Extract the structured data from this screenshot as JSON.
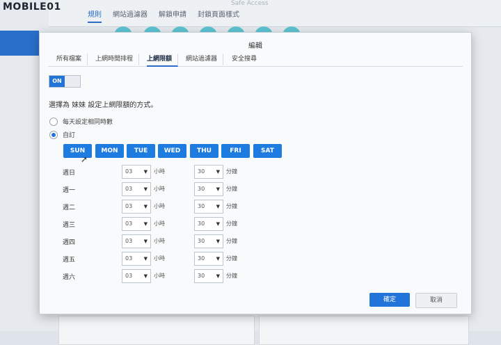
{
  "watermark": "MOBILE01",
  "background": {
    "site_title": "Safe Access",
    "tabs": [
      "規則",
      "網站過濾器",
      "解鎖申請",
      "封鎖頁面樣式"
    ]
  },
  "dialog": {
    "title": "編輯",
    "tabs": [
      "所有檔案",
      "上網時間排程",
      "上網限額",
      "網站過濾器",
      "安全搜尋"
    ],
    "active_tab": "上網限額",
    "toggle_label": "ON",
    "prompt": "選擇為 妹妹 設定上網限額的方式。",
    "options": [
      {
        "label": "每天設定相同時數",
        "checked": false
      },
      {
        "label": "自訂",
        "checked": true
      }
    ],
    "days": [
      "SUN",
      "MON",
      "TUE",
      "WED",
      "THU",
      "FRI",
      "SAT"
    ],
    "rows": [
      {
        "label": "週日",
        "hours": "03",
        "hours_unit": "小時",
        "minutes": "30",
        "minutes_unit": "分鐘"
      },
      {
        "label": "週一",
        "hours": "03",
        "hours_unit": "小時",
        "minutes": "30",
        "minutes_unit": "分鐘"
      },
      {
        "label": "週二",
        "hours": "03",
        "hours_unit": "小時",
        "minutes": "30",
        "minutes_unit": "分鐘"
      },
      {
        "label": "週三",
        "hours": "03",
        "hours_unit": "小時",
        "minutes": "30",
        "minutes_unit": "分鐘"
      },
      {
        "label": "週四",
        "hours": "03",
        "hours_unit": "小時",
        "minutes": "30",
        "minutes_unit": "分鐘"
      },
      {
        "label": "週五",
        "hours": "03",
        "hours_unit": "小時",
        "minutes": "30",
        "minutes_unit": "分鐘"
      },
      {
        "label": "週六",
        "hours": "03",
        "hours_unit": "小時",
        "minutes": "30",
        "minutes_unit": "分鐘"
      }
    ],
    "ok_label": "確定",
    "cancel_label": "取消"
  },
  "colors": {
    "accent": "#2374d8",
    "day_button": "#1e7be0"
  }
}
